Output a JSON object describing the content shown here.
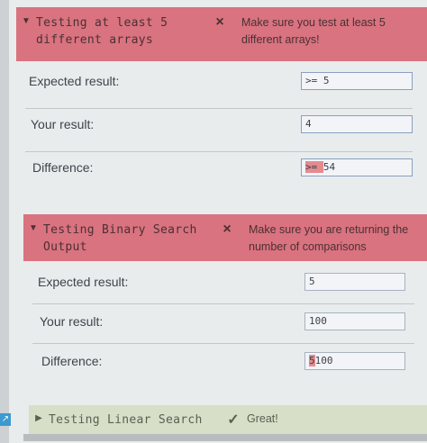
{
  "tests": [
    {
      "name": "Testing at least 5 different arrays",
      "status_icon": "×",
      "message": "Make sure you test at least 5 different arrays!",
      "rows": [
        {
          "label": "Expected result:",
          "value": ">= 5"
        },
        {
          "label": "Your result:",
          "value": "4"
        },
        {
          "label": "Difference:",
          "value_highlight": ">= ",
          "value_rest": "54"
        }
      ]
    },
    {
      "name": "Testing Binary Search Output",
      "status_icon": "×",
      "message": "Make sure you are returning the number of comparisons",
      "rows": [
        {
          "label": "Expected result:",
          "value": "5"
        },
        {
          "label": "Your result:",
          "value": "100"
        },
        {
          "label": "Difference:",
          "value_highlight": "5",
          "value_rest": "100"
        }
      ]
    },
    {
      "name": "Testing Linear Search",
      "status_icon": "✓",
      "message": "Great!"
    }
  ],
  "colors": {
    "fail_header": "#d9737f",
    "pass_header": "#d7dfc9",
    "value_border": "#8a9fc0",
    "highlight": "#e58b90"
  },
  "icons": {
    "expanded": "caret-down-icon",
    "collapsed": "caret-right-icon",
    "fail": "x-icon",
    "pass": "check-icon"
  }
}
